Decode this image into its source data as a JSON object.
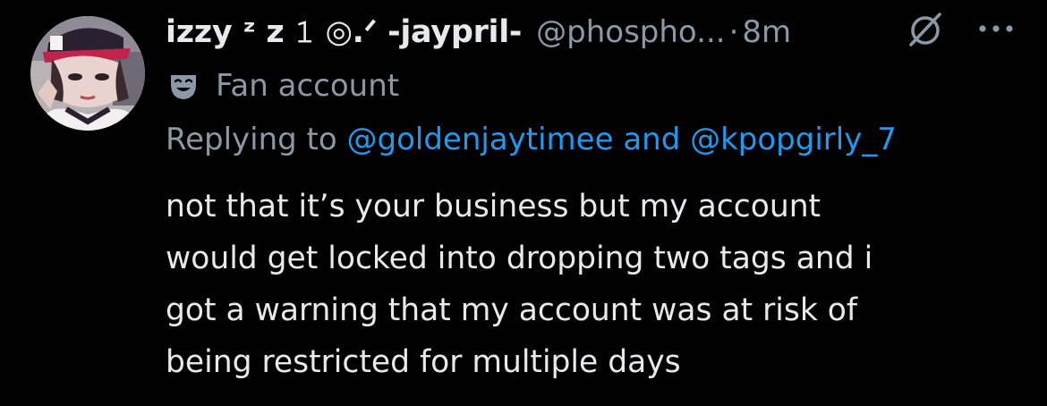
{
  "tweet": {
    "author": {
      "display_name": "izzy ᶻ z 𝟷 ◎.ᐟ -jaypril-",
      "handle": "@phospho...",
      "label": "Fan account",
      "avatar_icon": "avatar-photo"
    },
    "separator": "·",
    "timestamp": "8m",
    "reply_prefix": "Replying to",
    "reply_mentions": [
      "@goldenjaytimee",
      "@kpopgirly_7"
    ],
    "reply_conjunction": "and",
    "text_lines": [
      "not that it’s your business but my account",
      "would get locked into dropping two tags and i",
      "got a warning that my account was at risk of",
      "being restricted for multiple days"
    ]
  },
  "icons": {
    "hidden": "eye-slash-icon",
    "more": "more-options-icon",
    "label": "mask-icon"
  },
  "colors": {
    "background": "#000000",
    "primary_text": "#e7e9ea",
    "secondary_text": "#8b98a5",
    "accent": "#1d9bf0"
  }
}
